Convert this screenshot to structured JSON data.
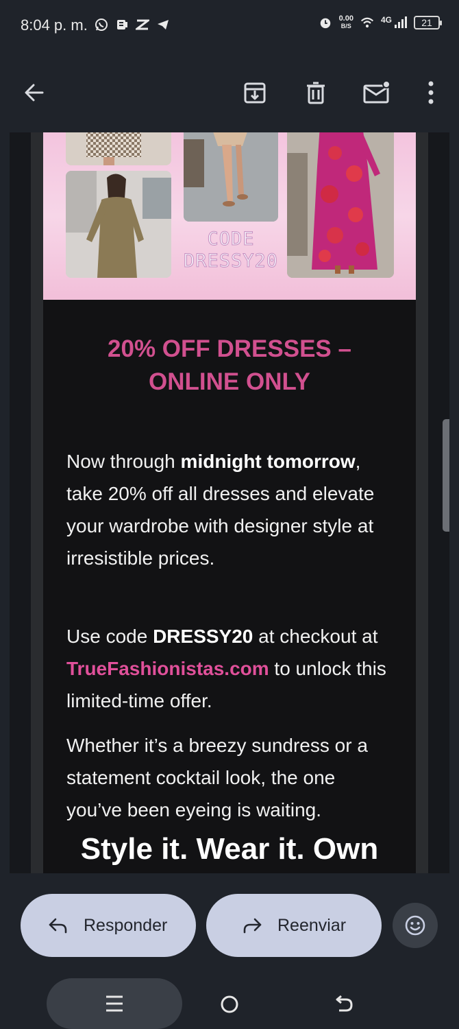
{
  "status_bar": {
    "time": "8:04 p. m.",
    "net_speed_value": "0.00",
    "net_speed_unit": "B/S",
    "network": "4G",
    "battery": "21",
    "icons": [
      "whatsapp-icon",
      "app-notification-icon",
      "capcut-icon",
      "telegram-icon",
      "alarm-icon",
      "wifi-icon",
      "signal-icon",
      "battery-icon"
    ]
  },
  "app_bar": {
    "icons": [
      "back-arrow-icon",
      "archive-icon",
      "delete-icon",
      "mark-unread-icon",
      "more-options-icon"
    ]
  },
  "email": {
    "banner": {
      "code_line1": "CODE",
      "code_line2": "DRESSY20"
    },
    "headline_line1": "20% OFF DRESSES –",
    "headline_line2": "ONLINE ONLY",
    "para1_pre": "Now through ",
    "para1_bold": "midnight tomorrow",
    "para1_post": ", take 20% off all dresses and elevate your wardrobe with designer style at irresistible prices.",
    "para2_pre": "Use code ",
    "para2_bold": "DRESSY20",
    "para2_mid": " at checkout at ",
    "para2_link": "TrueFashionistas.com",
    "para2_post": " to unlock this limited-time offer.",
    "para3": "Whether it’s a breezy sundress or a statement cocktail look, the one you’ve been eyeing is waiting.",
    "tagline": "Style it. Wear it. Own"
  },
  "actions": {
    "reply_label": "Responder",
    "forward_label": "Reenviar"
  },
  "colors": {
    "accent_pink": "#d1508f",
    "link_pink": "#e0509a",
    "button_bg": "#c9cfe3"
  }
}
